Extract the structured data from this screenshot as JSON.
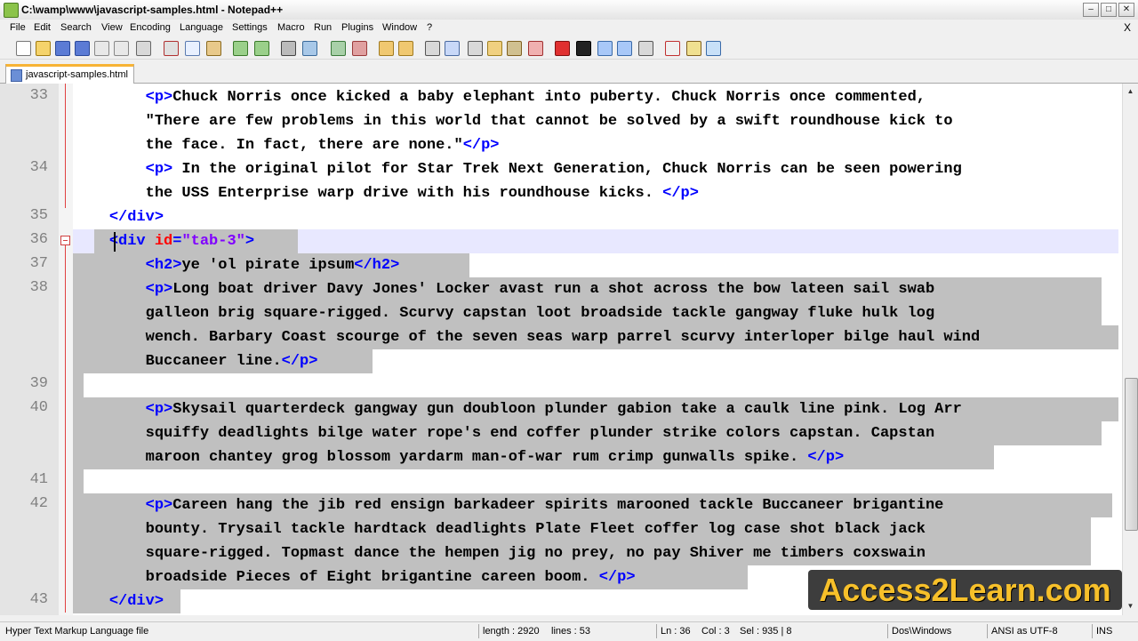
{
  "window": {
    "title": "C:\\wamp\\www\\javascript-samples.html - Notepad++"
  },
  "menu": [
    "File",
    "Edit",
    "Search",
    "View",
    "Encoding",
    "Language",
    "Settings",
    "Macro",
    "Run",
    "Plugins",
    "Window",
    "?"
  ],
  "menu_close": "X",
  "tab": {
    "label": "javascript-samples.html"
  },
  "editor": {
    "line_numbers": [
      {
        "n": "33",
        "row": 0
      },
      {
        "n": "34",
        "row": 3
      },
      {
        "n": "35",
        "row": 5
      },
      {
        "n": "36",
        "row": 6
      },
      {
        "n": "37",
        "row": 7
      },
      {
        "n": "38",
        "row": 8
      },
      {
        "n": "39",
        "row": 12
      },
      {
        "n": "40",
        "row": 13
      },
      {
        "n": "41",
        "row": 16
      },
      {
        "n": "42",
        "row": 17
      },
      {
        "n": "43",
        "row": 21
      }
    ],
    "rows": [
      {
        "indent": "        ",
        "parts": [
          [
            "tag",
            "<p>"
          ],
          [
            "txt",
            "Chuck Norris once kicked a baby elephant into puberty. Chuck Norris once commented,"
          ]
        ]
      },
      {
        "indent": "        ",
        "parts": [
          [
            "txt",
            "\"There are few problems in this world that cannot be solved by a swift roundhouse kick to"
          ]
        ]
      },
      {
        "indent": "        ",
        "parts": [
          [
            "txt",
            "the face. In fact, there are none.\""
          ],
          [
            "tag",
            "</p>"
          ]
        ]
      },
      {
        "indent": "        ",
        "parts": [
          [
            "tag",
            "<p>"
          ],
          [
            "txt",
            " In the original pilot for Star Trek Next Generation, Chuck Norris can be seen powering"
          ]
        ]
      },
      {
        "indent": "        ",
        "parts": [
          [
            "txt",
            "the USS Enterprise warp drive with his roundhouse kicks. "
          ],
          [
            "tag",
            "</p>"
          ]
        ]
      },
      {
        "indent": "    ",
        "parts": [
          [
            "tag",
            "</div>"
          ]
        ]
      },
      {
        "indent": "    ",
        "parts": [
          [
            "tag",
            "<div "
          ],
          [
            "attr",
            "id"
          ],
          [
            "tag",
            "="
          ],
          [
            "val",
            "\"tab-3\""
          ],
          [
            "tag",
            ">"
          ]
        ]
      },
      {
        "indent": "        ",
        "parts": [
          [
            "tag",
            "<h2>"
          ],
          [
            "txt",
            "ye 'ol pirate ipsum"
          ],
          [
            "tag",
            "</h2>"
          ]
        ]
      },
      {
        "indent": "        ",
        "parts": [
          [
            "tag",
            "<p>"
          ],
          [
            "txt",
            "Long boat driver Davy Jones' Locker avast run a shot across the bow lateen sail swab"
          ]
        ]
      },
      {
        "indent": "        ",
        "parts": [
          [
            "txt",
            "galleon brig square-rigged. Scurvy capstan loot broadside tackle gangway fluke hulk log"
          ]
        ]
      },
      {
        "indent": "        ",
        "parts": [
          [
            "txt",
            "wench. Barbary Coast scourge of the seven seas warp parrel scurvy interloper bilge haul wind"
          ]
        ]
      },
      {
        "indent": "        ",
        "parts": [
          [
            "txt",
            "Buccaneer line."
          ],
          [
            "tag",
            "</p>"
          ]
        ]
      },
      {
        "indent": "",
        "parts": []
      },
      {
        "indent": "        ",
        "parts": [
          [
            "tag",
            "<p>"
          ],
          [
            "txt",
            "Skysail quarterdeck gangway gun doubloon plunder gabion take a caulk line pink. Log Arr"
          ]
        ]
      },
      {
        "indent": "        ",
        "parts": [
          [
            "txt",
            "squiffy deadlights bilge water rope's end coffer plunder strike colors capstan. Capstan"
          ]
        ]
      },
      {
        "indent": "        ",
        "parts": [
          [
            "txt",
            "maroon chantey grog blossom yardarm man-of-war rum crimp gunwalls spike. "
          ],
          [
            "tag",
            "</p>"
          ]
        ]
      },
      {
        "indent": "",
        "parts": []
      },
      {
        "indent": "        ",
        "parts": [
          [
            "tag",
            "<p>"
          ],
          [
            "txt",
            "Careen hang the jib red ensign barkadeer spirits marooned tackle Buccaneer brigantine"
          ]
        ]
      },
      {
        "indent": "        ",
        "parts": [
          [
            "txt",
            "bounty. Trysail tackle hardtack deadlights Plate Fleet coffer log case shot black jack"
          ]
        ]
      },
      {
        "indent": "        ",
        "parts": [
          [
            "txt",
            "square-rigged. Topmast dance the hempen jig no prey, no pay Shiver me timbers coxswain"
          ]
        ]
      },
      {
        "indent": "        ",
        "parts": [
          [
            "txt",
            "broadside Pieces of Eight brigantine careen boom. "
          ],
          [
            "tag",
            "</p>"
          ]
        ]
      },
      {
        "indent": "    ",
        "parts": [
          [
            "tag",
            "</div>"
          ]
        ]
      }
    ]
  },
  "status": {
    "type": "Hyper Text Markup Language file",
    "length": "length : 2920",
    "lines": "lines : 53",
    "ln": "Ln : 36",
    "col": "Col : 3",
    "sel": "Sel : 935 | 8",
    "eol": "Dos\\Windows",
    "encoding": "ANSI as UTF-8",
    "mode": "INS"
  },
  "watermark": "Access2Learn.com",
  "colors": {
    "tag": "#0000ff",
    "attr": "#ff0000",
    "value": "#8000ff",
    "selection": "#c0c0c0",
    "current_line": "#e8e8ff",
    "watermark": "#f7c02a"
  }
}
